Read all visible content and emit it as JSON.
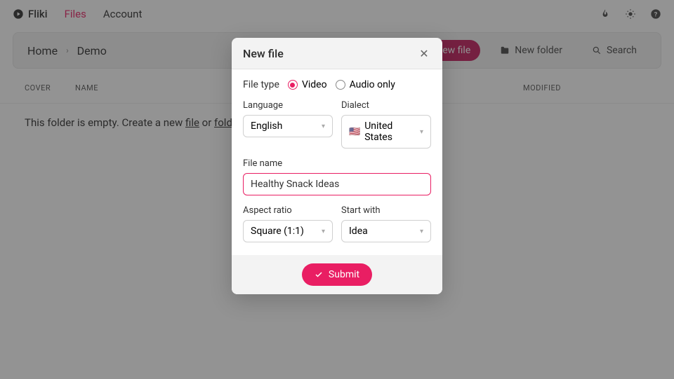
{
  "brand": "Fliki",
  "nav": {
    "files": "Files",
    "account": "Account"
  },
  "breadcrumb": {
    "home": "Home",
    "current": "Demo"
  },
  "toolbar": {
    "new_file": "New file",
    "new_folder": "New folder",
    "search": "Search"
  },
  "table": {
    "cover": "COVER",
    "name": "NAME",
    "modified": "MODIFIED"
  },
  "empty": {
    "prefix": "This folder is empty. Create a new ",
    "file": "file",
    "or": " or ",
    "folder": "folder",
    "suffix": "."
  },
  "modal": {
    "title": "New file",
    "file_type_label": "File type",
    "video": "Video",
    "audio_only": "Audio only",
    "language_label": "Language",
    "language_value": "English",
    "dialect_label": "Dialect",
    "dialect_flag": "🇺🇸",
    "dialect_value": "United States",
    "file_name_label": "File name",
    "file_name_value": "Healthy Snack Ideas",
    "aspect_label": "Aspect ratio",
    "aspect_value": "Square (1:1)",
    "start_label": "Start with",
    "start_value": "Idea",
    "submit": "Submit"
  }
}
